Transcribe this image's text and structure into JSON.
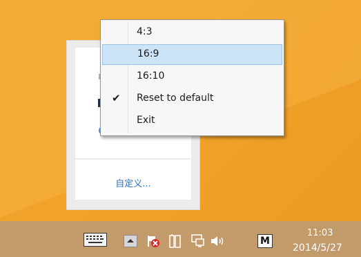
{
  "flyout": {
    "customize_label": "自定义..."
  },
  "menu": {
    "items": [
      {
        "label": "4:3",
        "checked": false,
        "highlighted": false
      },
      {
        "label": "16:9",
        "checked": false,
        "highlighted": true
      },
      {
        "label": "16:10",
        "checked": false,
        "highlighted": false
      },
      {
        "label": "Reset to default",
        "checked": true,
        "highlighted": false
      },
      {
        "label": "Exit",
        "checked": false,
        "highlighted": false
      }
    ],
    "check_glyph": "✔"
  },
  "taskbar": {
    "ime_label": "M",
    "clock_time": "11:03",
    "clock_date": "2014/5/27",
    "icons": [
      "keyboard-icon",
      "show-hidden-icons-arrow",
      "action-center-flag-icon",
      "power-icon",
      "network-icon",
      "volume-icon",
      "ime-mode-icon"
    ]
  },
  "colors": {
    "menu_highlight": "#cce4f7",
    "taskbar": "#c39a6a",
    "link": "#2a73c7"
  }
}
